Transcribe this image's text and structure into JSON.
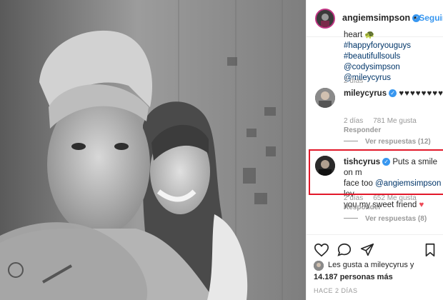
{
  "post": {
    "username": "angiemsimpson",
    "separator": "•",
    "follow": "Seguir",
    "caption_lines": [
      "heart",
      "#happyforyouguys",
      "#beautifullsouls @codysimpson",
      "@mileycyrus"
    ],
    "caption_emoji": "🐢",
    "caption_time": "2 días"
  },
  "comments": [
    {
      "username": "mileycyrus",
      "text": "♥♥♥♥♥♥♥♥",
      "time": "2 días",
      "likes": "781 Me gusta",
      "reply": "Responder",
      "view_replies": "Ver respuestas (12)"
    },
    {
      "username": "tishcyrus",
      "text": "Puts a smile on my face too @angiemsimpson love you my sweet friend",
      "text_parts": [
        "Puts a smile on m",
        "face too ",
        "@angiemsimpson",
        " lov",
        "you my sweet friend"
      ],
      "heart": "♥",
      "time": "2 días",
      "likes": "652 Me gusta",
      "reply": "Responder",
      "view_replies": "Ver respuestas (8)"
    }
  ],
  "likes_summary": {
    "line1": "Les gusta a mileycyrus y",
    "line2": "14.187 personas más"
  },
  "time_ago": "HACE 2 DÍAS",
  "icons": [
    "heart-icon",
    "comment-icon",
    "share-icon",
    "bookmark-icon",
    "verified-badge-icon"
  ],
  "colors": {
    "link": "#3897f0",
    "highlight_border": "#e2182a",
    "heart_red": "#ed4956",
    "verified": "#3897f0"
  }
}
